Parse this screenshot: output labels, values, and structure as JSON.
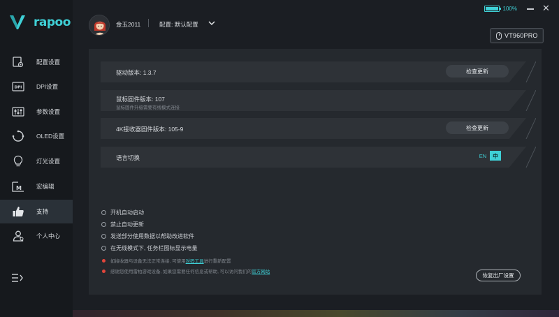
{
  "brand": {
    "logo_text": "rapoo",
    "accent": "#3fd0d6"
  },
  "sidebar": {
    "items": [
      {
        "label": "配置设置",
        "icon": "config-icon"
      },
      {
        "label": "DPI设置",
        "icon": "dpi-icon"
      },
      {
        "label": "参数设置",
        "icon": "sliders-icon"
      },
      {
        "label": "OLED设置",
        "icon": "oled-icon"
      },
      {
        "label": "灯光设置",
        "icon": "bulb-icon"
      },
      {
        "label": "宏编辑",
        "icon": "macro-icon"
      },
      {
        "label": "支持",
        "icon": "thumbs-up-icon",
        "active": true
      },
      {
        "label": "个人中心",
        "icon": "user-icon"
      }
    ],
    "collapse_icon": "menu-collapse-icon"
  },
  "header": {
    "username": "金玉2011",
    "config_label": "配置: 默认配置",
    "battery": "100%",
    "battery_level": 1.0,
    "device": "VT960PRO"
  },
  "main": {
    "rows": [
      {
        "title": "驱动版本: 1.3.7",
        "button": "检查更新"
      },
      {
        "title": "鼠标固件版本: 107",
        "subtitle": "鼠标固件升级需要有线模式连接"
      },
      {
        "title": "4K接收器固件版本: 105-9",
        "button": "检查更新"
      },
      {
        "title": "语言切换",
        "lang_en": "EN",
        "lang_zh": "中"
      }
    ],
    "options": [
      "开机自动启动",
      "禁止自动更新",
      "发送部分使用数据以帮助改进软件",
      "在无线模式下, 任务栏图标显示电量"
    ],
    "notes": [
      {
        "before": "如接收器与设备无法正常连接, 可使用",
        "link": "对码工具",
        "after": "进行重新配置"
      },
      {
        "before": "感谢您使用雷柏游戏设备, 如果您需要任何信息或帮助, 可以访问我们的",
        "link": "官方网站",
        "after": ""
      }
    ],
    "reset_button": "恢复出厂设置"
  }
}
